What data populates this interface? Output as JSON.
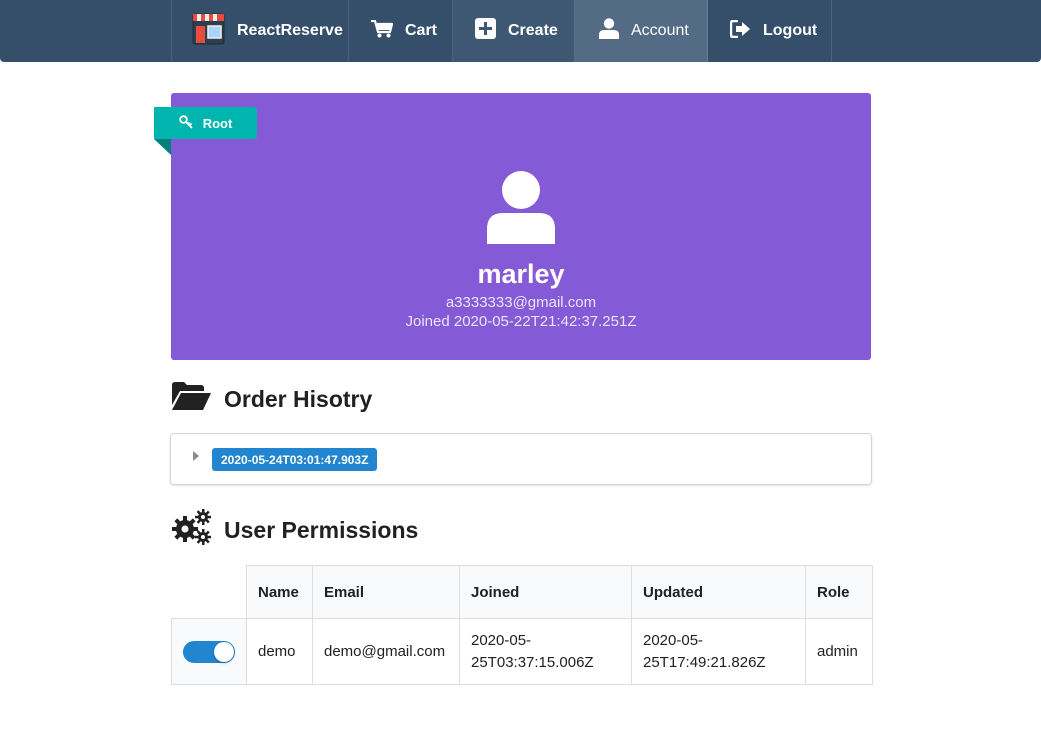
{
  "nav": {
    "brand": "ReactReserve",
    "cart": "Cart",
    "create": "Create",
    "account": "Account",
    "logout": "Logout",
    "active_item": "Account"
  },
  "profile": {
    "role_badge": "Root",
    "name": "marley",
    "email": "a3333333@gmail.com",
    "joined": "Joined 2020-05-22T21:42:37.251Z",
    "card_color": "#845ad6"
  },
  "orders": {
    "heading": "Order Hisotry",
    "items": [
      {
        "label": "2020-05-24T03:01:47.903Z"
      }
    ]
  },
  "permissions": {
    "heading": "User Permissions",
    "columns": [
      "Name",
      "Email",
      "Joined",
      "Updated",
      "Role"
    ],
    "rows": [
      {
        "admin_toggle": true,
        "name": "demo",
        "email": "demo@gmail.com",
        "joined_line1": "2020-05-",
        "joined_line2": "25T03:37:15.006Z",
        "updated_line1": "2020-05-",
        "updated_line2": "25T17:49:21.826Z",
        "role": "admin"
      }
    ]
  },
  "icons": {
    "brand": "store-icon",
    "cart": "cart-icon",
    "create": "plus-square-icon",
    "account": "user-icon",
    "logout": "sign-out-icon",
    "root": "key-icon",
    "avatar": "user-icon",
    "orders": "folder-open-icon",
    "permissions": "cogs-icon"
  },
  "colors": {
    "navbar": "#354f6b",
    "accent_teal": "#00b5ad",
    "primary_blue": "#2185d0"
  }
}
